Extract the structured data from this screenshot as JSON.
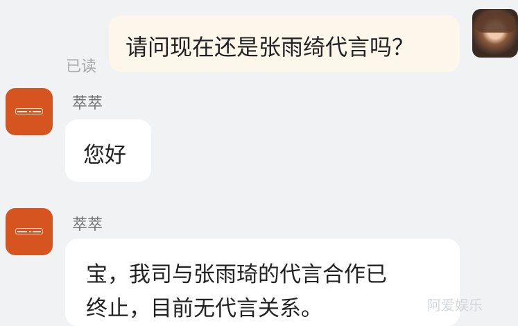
{
  "outgoing": {
    "text": "请问现在还是张雨绮代言吗？"
  },
  "read_status": "已读",
  "messages": [
    {
      "sender": "萃萃",
      "lines": [
        "您好"
      ]
    },
    {
      "sender": "萃萃",
      "lines": [
        "宝，我司与张雨琦的代言合作已",
        "终止，目前无代言关系。"
      ]
    }
  ],
  "watermark": "阿爱娱乐",
  "colors": {
    "background": "#f1f2f4",
    "outgoing_bubble": "#fdf6ea",
    "incoming_bubble": "#ffffff",
    "brand_avatar": "#d5541f"
  }
}
